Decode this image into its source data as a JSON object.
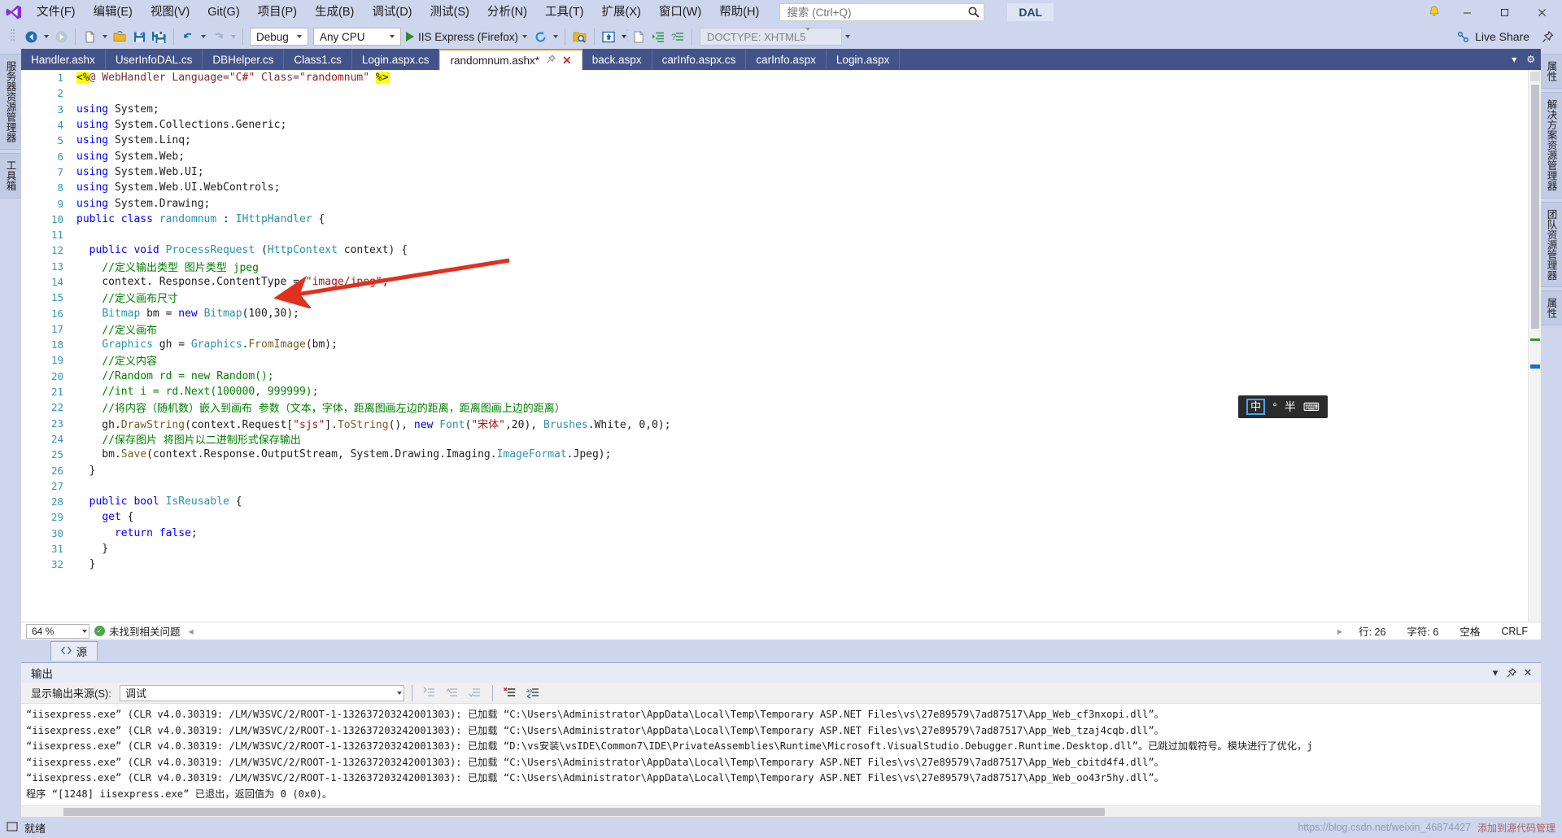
{
  "window": {
    "title_badge": "DAL",
    "live_share": "Live Share"
  },
  "menu": {
    "items": [
      {
        "label": "文件(F)"
      },
      {
        "label": "编辑(E)"
      },
      {
        "label": "视图(V)"
      },
      {
        "label": "Git(G)"
      },
      {
        "label": "项目(P)"
      },
      {
        "label": "生成(B)"
      },
      {
        "label": "调试(D)"
      },
      {
        "label": "测试(S)"
      },
      {
        "label": "分析(N)"
      },
      {
        "label": "工具(T)"
      },
      {
        "label": "扩展(X)"
      },
      {
        "label": "窗口(W)"
      },
      {
        "label": "帮助(H)"
      }
    ]
  },
  "search": {
    "placeholder": "搜索 (Ctrl+Q)",
    "value": ""
  },
  "toolbar": {
    "configuration": "Debug",
    "platform": "Any CPU",
    "run_target": "IIS Express (Firefox)",
    "doctype": "DOCTYPE: XHTML5"
  },
  "window_controls": {
    "minimize": "─",
    "maximize": "☐",
    "close": "✕"
  },
  "left_rail": [
    {
      "label": "服务器资源管理器"
    },
    {
      "label": "工具箱"
    }
  ],
  "right_rail": [
    {
      "label": "属性"
    },
    {
      "label": "团队资源管理器"
    },
    {
      "label": "解决方案资源管理器"
    },
    {
      "label": "属性"
    }
  ],
  "tabs": [
    {
      "label": "Handler.ashx",
      "active": false,
      "modified": false
    },
    {
      "label": "UserInfoDAL.cs",
      "active": false,
      "modified": false
    },
    {
      "label": "DBHelper.cs",
      "active": false,
      "modified": false
    },
    {
      "label": "Class1.cs",
      "active": false,
      "modified": false
    },
    {
      "label": "Login.aspx.cs",
      "active": false,
      "modified": false
    },
    {
      "label": "randomnum.ashx*",
      "active": true,
      "modified": true
    },
    {
      "label": "back.aspx",
      "active": false,
      "modified": false
    },
    {
      "label": "carInfo.aspx.cs",
      "active": false,
      "modified": false
    },
    {
      "label": "carInfo.aspx",
      "active": false,
      "modified": false
    },
    {
      "label": "Login.aspx",
      "active": false,
      "modified": false
    }
  ],
  "editor": {
    "file": "randomnum.ashx",
    "lines": [
      {
        "n": 1,
        "html": "<span class=\"hl\">&lt;%</span><span class=\"pp\">@ WebHandler Language=</span><span class=\"str\">\"C#\"</span><span class=\"pp\"> Class=</span><span class=\"str\">\"randomnum\"</span> <span class=\"hl\">%&gt;</span>"
      },
      {
        "n": 2,
        "html": ""
      },
      {
        "n": 3,
        "html": "<span class=\"k\">using</span> System;"
      },
      {
        "n": 4,
        "html": "<span class=\"k\">using</span> System.Collections.Generic;"
      },
      {
        "n": 5,
        "html": "<span class=\"k\">using</span> System.Linq;"
      },
      {
        "n": 6,
        "html": "<span class=\"k\">using</span> System.Web;"
      },
      {
        "n": 7,
        "html": "<span class=\"k\">using</span> System.Web.UI;"
      },
      {
        "n": 8,
        "html": "<span class=\"k\">using</span> System.Web.UI.WebControls;"
      },
      {
        "n": 9,
        "html": "<span class=\"k\">using</span> System.Drawing;"
      },
      {
        "n": 10,
        "html": "<span class=\"k\">public</span> <span class=\"k\">class</span> <span class=\"ty\">randomnum</span> : <span class=\"ty\">IHttpHandler</span> {"
      },
      {
        "n": 11,
        "html": ""
      },
      {
        "n": 12,
        "html": "  <span class=\"k\">public</span> <span class=\"k\">void</span> <span class=\"ty\">ProcessRequest</span> (<span class=\"ty\">HttpContext</span> context) {"
      },
      {
        "n": 13,
        "html": "    <span class=\"cm\">//定义输出类型 图片类型 jpeg</span>"
      },
      {
        "n": 14,
        "html": "    context. Response.ContentType = <span class=\"str\">\"image/jpeg\"</span>;"
      },
      {
        "n": 15,
        "html": "    <span class=\"cm\">//定义画布尺寸</span>"
      },
      {
        "n": 16,
        "html": "    <span class=\"ty\">Bitmap</span> bm = <span class=\"k\">new</span> <span class=\"ty\">Bitmap</span>(100,30);"
      },
      {
        "n": 17,
        "html": "    <span class=\"cm\">//定义画布</span>"
      },
      {
        "n": 18,
        "html": "    <span class=\"ty\">Graphics</span> gh = <span class=\"ty\">Graphics</span>.<span class=\"fn\">FromImage</span>(bm);"
      },
      {
        "n": 19,
        "html": "    <span class=\"cm\">//定义内容</span>"
      },
      {
        "n": 20,
        "html": "    <span class=\"cm\">//Random rd = new Random();</span>"
      },
      {
        "n": 21,
        "html": "    <span class=\"cm\">//int i = rd.Next(100000, 999999);</span>"
      },
      {
        "n": 22,
        "html": "    <span class=\"cm\">//将内容（随机数）嵌入到画布 参数（文本，字体，距离图画左边的距离，距离图画上边的距离）</span>"
      },
      {
        "n": 23,
        "html": "    gh.<span class=\"fn\">DrawString</span>(context.Request[<span class=\"str\">\"sjs\"</span>].<span class=\"fn\">ToString</span>(), <span class=\"k\">new</span> <span class=\"ty\">Font</span>(<span class=\"str\">\"宋体\"</span>,20), <span class=\"ty\">Brushes</span>.White, 0,0);"
      },
      {
        "n": 24,
        "html": "    <span class=\"cm\">//保存图片 将图片以二进制形式保存输出</span>"
      },
      {
        "n": 25,
        "html": "    bm.<span class=\"fn\">Save</span>(context.Response.OutputStream, System.Drawing.Imaging.<span class=\"ty\">ImageFormat</span>.Jpeg);"
      },
      {
        "n": 26,
        "html": "  }"
      },
      {
        "n": 27,
        "html": ""
      },
      {
        "n": 28,
        "html": "  <span class=\"k\">public</span> <span class=\"k\">bool</span> <span class=\"ty\">IsReusable</span> {"
      },
      {
        "n": 29,
        "html": "    <span class=\"k\">get</span> {"
      },
      {
        "n": 30,
        "html": "      <span class=\"k\">return</span> <span class=\"k\">false</span>;"
      },
      {
        "n": 31,
        "html": "    }"
      },
      {
        "n": 32,
        "html": "  }"
      }
    ]
  },
  "editor_status": {
    "zoom": "64 %",
    "problems": "未找到相关问题",
    "line": "行: 26",
    "column": "字符: 6",
    "spaces": "空格",
    "eol": "CRLF"
  },
  "designer_bar": {
    "source_label": "源"
  },
  "output": {
    "panel_title": "输出",
    "source_label": "显示输出来源(S):",
    "source_value": "调试",
    "lines": [
      "“iisexpress.exe” (CLR v4.0.30319: /LM/W3SVC/2/ROOT-1-132637203242001303): 已加载 “C:\\Users\\Administrator\\AppData\\Local\\Temp\\Temporary ASP.NET Files\\vs\\27e89579\\7ad87517\\App_Web_cf3nxopi.dll”。",
      "“iisexpress.exe” (CLR v4.0.30319: /LM/W3SVC/2/ROOT-1-132637203242001303): 已加载 “C:\\Users\\Administrator\\AppData\\Local\\Temp\\Temporary ASP.NET Files\\vs\\27e89579\\7ad87517\\App_Web_tzaj4cqb.dll”。",
      "“iisexpress.exe” (CLR v4.0.30319: /LM/W3SVC/2/ROOT-1-132637203242001303): 已加载 “D:\\vs安装\\vsIDE\\Common7\\IDE\\PrivateAssemblies\\Runtime\\Microsoft.VisualStudio.Debugger.Runtime.Desktop.dll”。已跳过加载符号。模块进行了优化，j",
      "“iisexpress.exe” (CLR v4.0.30319: /LM/W3SVC/2/ROOT-1-132637203242001303): 已加载 “C:\\Users\\Administrator\\AppData\\Local\\Temp\\Temporary ASP.NET Files\\vs\\27e89579\\7ad87517\\App_Web_cbitd4f4.dll”。",
      "“iisexpress.exe” (CLR v4.0.30319: /LM/W3SVC/2/ROOT-1-132637203242001303): 已加载 “C:\\Users\\Administrator\\AppData\\Local\\Temp\\Temporary ASP.NET Files\\vs\\27e89579\\7ad87517\\App_Web_oo43r5hy.dll”。",
      "程序 “[1248] iisexpress.exe” 已退出，返回值为 0 (0x0)。"
    ]
  },
  "statusbar": {
    "ready": "就绪",
    "url": "https://blog.csdn.net/weixin_46874427",
    "watermark": "添加到源代码管理"
  },
  "ime_popup": {
    "mode_key": "中",
    "degree": "°",
    "half": "半",
    "tool": "⌨"
  },
  "colors": {
    "chrome": "#cdd6ec",
    "tabstrip": "#43538a",
    "accent_orange": "#e08b1a",
    "keyword_blue": "#0000ff",
    "comment_green": "#008000",
    "string_red": "#a31515",
    "type_teal": "#2b91af",
    "annotation_red": "#e03020"
  }
}
